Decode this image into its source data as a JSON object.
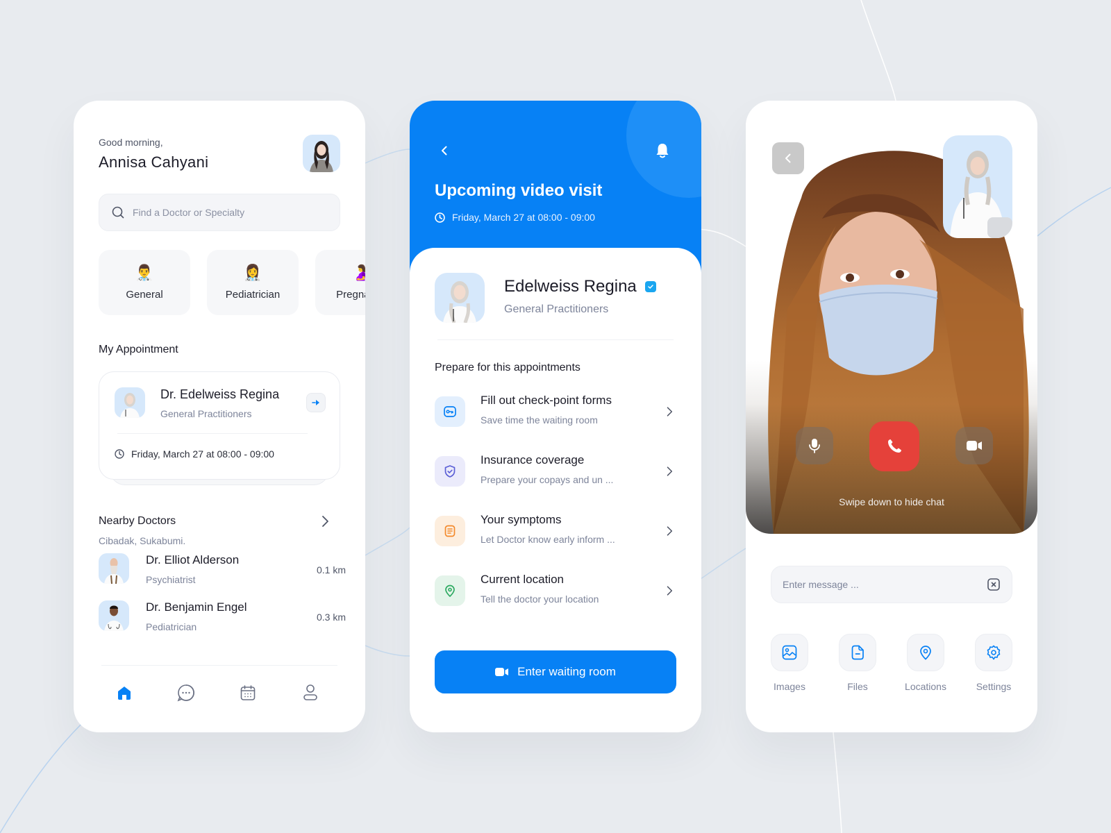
{
  "colors": {
    "primary": "#0781f5",
    "background": "#e8ebef",
    "end_call": "#e5413a",
    "muted_text": "#7d849a",
    "verified": "#1aa6f0"
  },
  "home": {
    "greeting": "Good morning,",
    "user_name": "Annisa Cahyani",
    "search_placeholder": "Find a Doctor or Specialty",
    "categories": [
      {
        "emoji": "👨‍⚕️",
        "label": "General"
      },
      {
        "emoji": "👩‍⚕️",
        "label": "Pediatrician"
      },
      {
        "emoji": "🤰",
        "label": "Pregnancy"
      }
    ],
    "appointment_title": "My Appointment",
    "appointment": {
      "doctor": "Dr. Edelweiss Regina",
      "specialty": "General Practitioners",
      "when": "Friday, March 27 at 08:00 - 09:00"
    },
    "nearby_title": "Nearby Doctors",
    "nearby_location": "Cibadak, Sukabumi.",
    "nearby": [
      {
        "name": "Dr. Elliot Alderson",
        "specialty": "Psychiatrist",
        "distance": "0.1 km"
      },
      {
        "name": "Dr. Benjamin Engel",
        "specialty": "Pediatrician",
        "distance": "0.3 km"
      }
    ],
    "tabs": [
      {
        "icon": "home-icon",
        "active": true
      },
      {
        "icon": "chat-icon",
        "active": false
      },
      {
        "icon": "calendar-icon",
        "active": false
      },
      {
        "icon": "profile-icon",
        "active": false
      }
    ]
  },
  "visit": {
    "title": "Upcoming video visit",
    "when": "Friday, March 27 at 08:00 - 09:00",
    "doctor": "Edelweiss Regina",
    "specialty": "General Practitioners",
    "prepare_title": "Prepare for this appointments",
    "items": [
      {
        "icon": "key-icon",
        "title": "Fill out check-point forms",
        "subtitle": "Save time the waiting room",
        "bg": "#e3effd",
        "fg": "#0781f5"
      },
      {
        "icon": "shield-check-icon",
        "title": "Insurance coverage",
        "subtitle": "Prepare your copays and un ...",
        "bg": "#ebebfb",
        "fg": "#5b5fd6"
      },
      {
        "icon": "document-icon",
        "title": "Your symptoms",
        "subtitle": "Let Doctor know early inform ...",
        "bg": "#fdeede",
        "fg": "#f38a2c"
      },
      {
        "icon": "location-pin-icon",
        "title": "Current location",
        "subtitle": "Tell the doctor your location",
        "bg": "#e4f4ea",
        "fg": "#2eaa62"
      }
    ],
    "cta": "Enter waiting room"
  },
  "call": {
    "swipe_hint": "Swipe down to hide chat",
    "message_placeholder": "Enter message ...",
    "attachments": [
      {
        "icon": "image-icon",
        "label": "Images"
      },
      {
        "icon": "file-icon",
        "label": "Files"
      },
      {
        "icon": "location-pin-icon",
        "label": "Locations"
      },
      {
        "icon": "settings-icon",
        "label": "Settings"
      }
    ]
  }
}
